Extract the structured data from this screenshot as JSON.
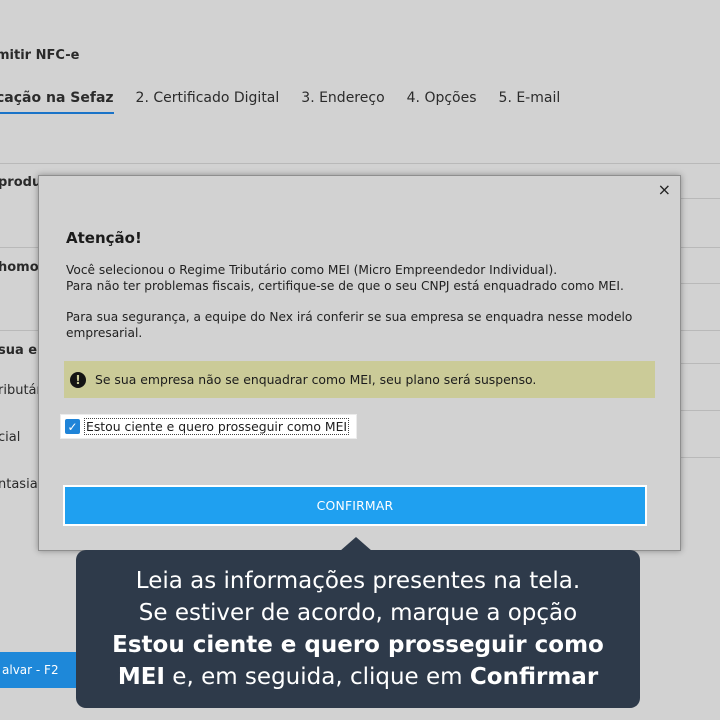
{
  "page": {
    "title": "mitir NFC-e",
    "tabs": [
      {
        "label": "cação na Sefaz",
        "active": true
      },
      {
        "label": "2. Certificado Digital"
      },
      {
        "label": "3. Endereço"
      },
      {
        "label": "4. Opções"
      },
      {
        "label": "5. E-mail"
      }
    ],
    "labels": [
      "produ",
      "homo",
      "sua en",
      "ributár",
      "cial",
      "ntasia"
    ],
    "save_button": "alvar - F2"
  },
  "modal": {
    "close": "×",
    "title": "Atenção!",
    "p1_line1": "Você selecionou o Regime Tributário como MEI (Micro Empreendedor Individual).",
    "p1_line2": "Para não ter problemas fiscais, certifique-se de que o seu CNPJ está enquadrado como MEI.",
    "p2_line1": "Para sua segurança, a equipe do Nex irá conferir se sua empresa se enquadra nesse modelo",
    "p2_line2": "empresarial.",
    "warning_icon": "!",
    "warning": "Se sua empresa não se enquadrar como MEI, seu plano será suspenso.",
    "checkbox_checked": true,
    "checkbox_label": "Estou ciente e quero prosseguir como MEI",
    "confirm": "CONFIRMAR"
  },
  "tooltip": {
    "line1": "Leia as informações presentes na tela.",
    "line2": "Se estiver de acordo, marque a opção",
    "bold1": "Estou ciente e quero prosseguir como",
    "bold2": "MEI",
    "mid": " e, em seguida, clique em ",
    "bold3": "Confirmar"
  },
  "colors": {
    "accent": "#1fa0f0",
    "warning_bg": "#cbcb98",
    "tooltip_bg": "#2e3a4a"
  }
}
